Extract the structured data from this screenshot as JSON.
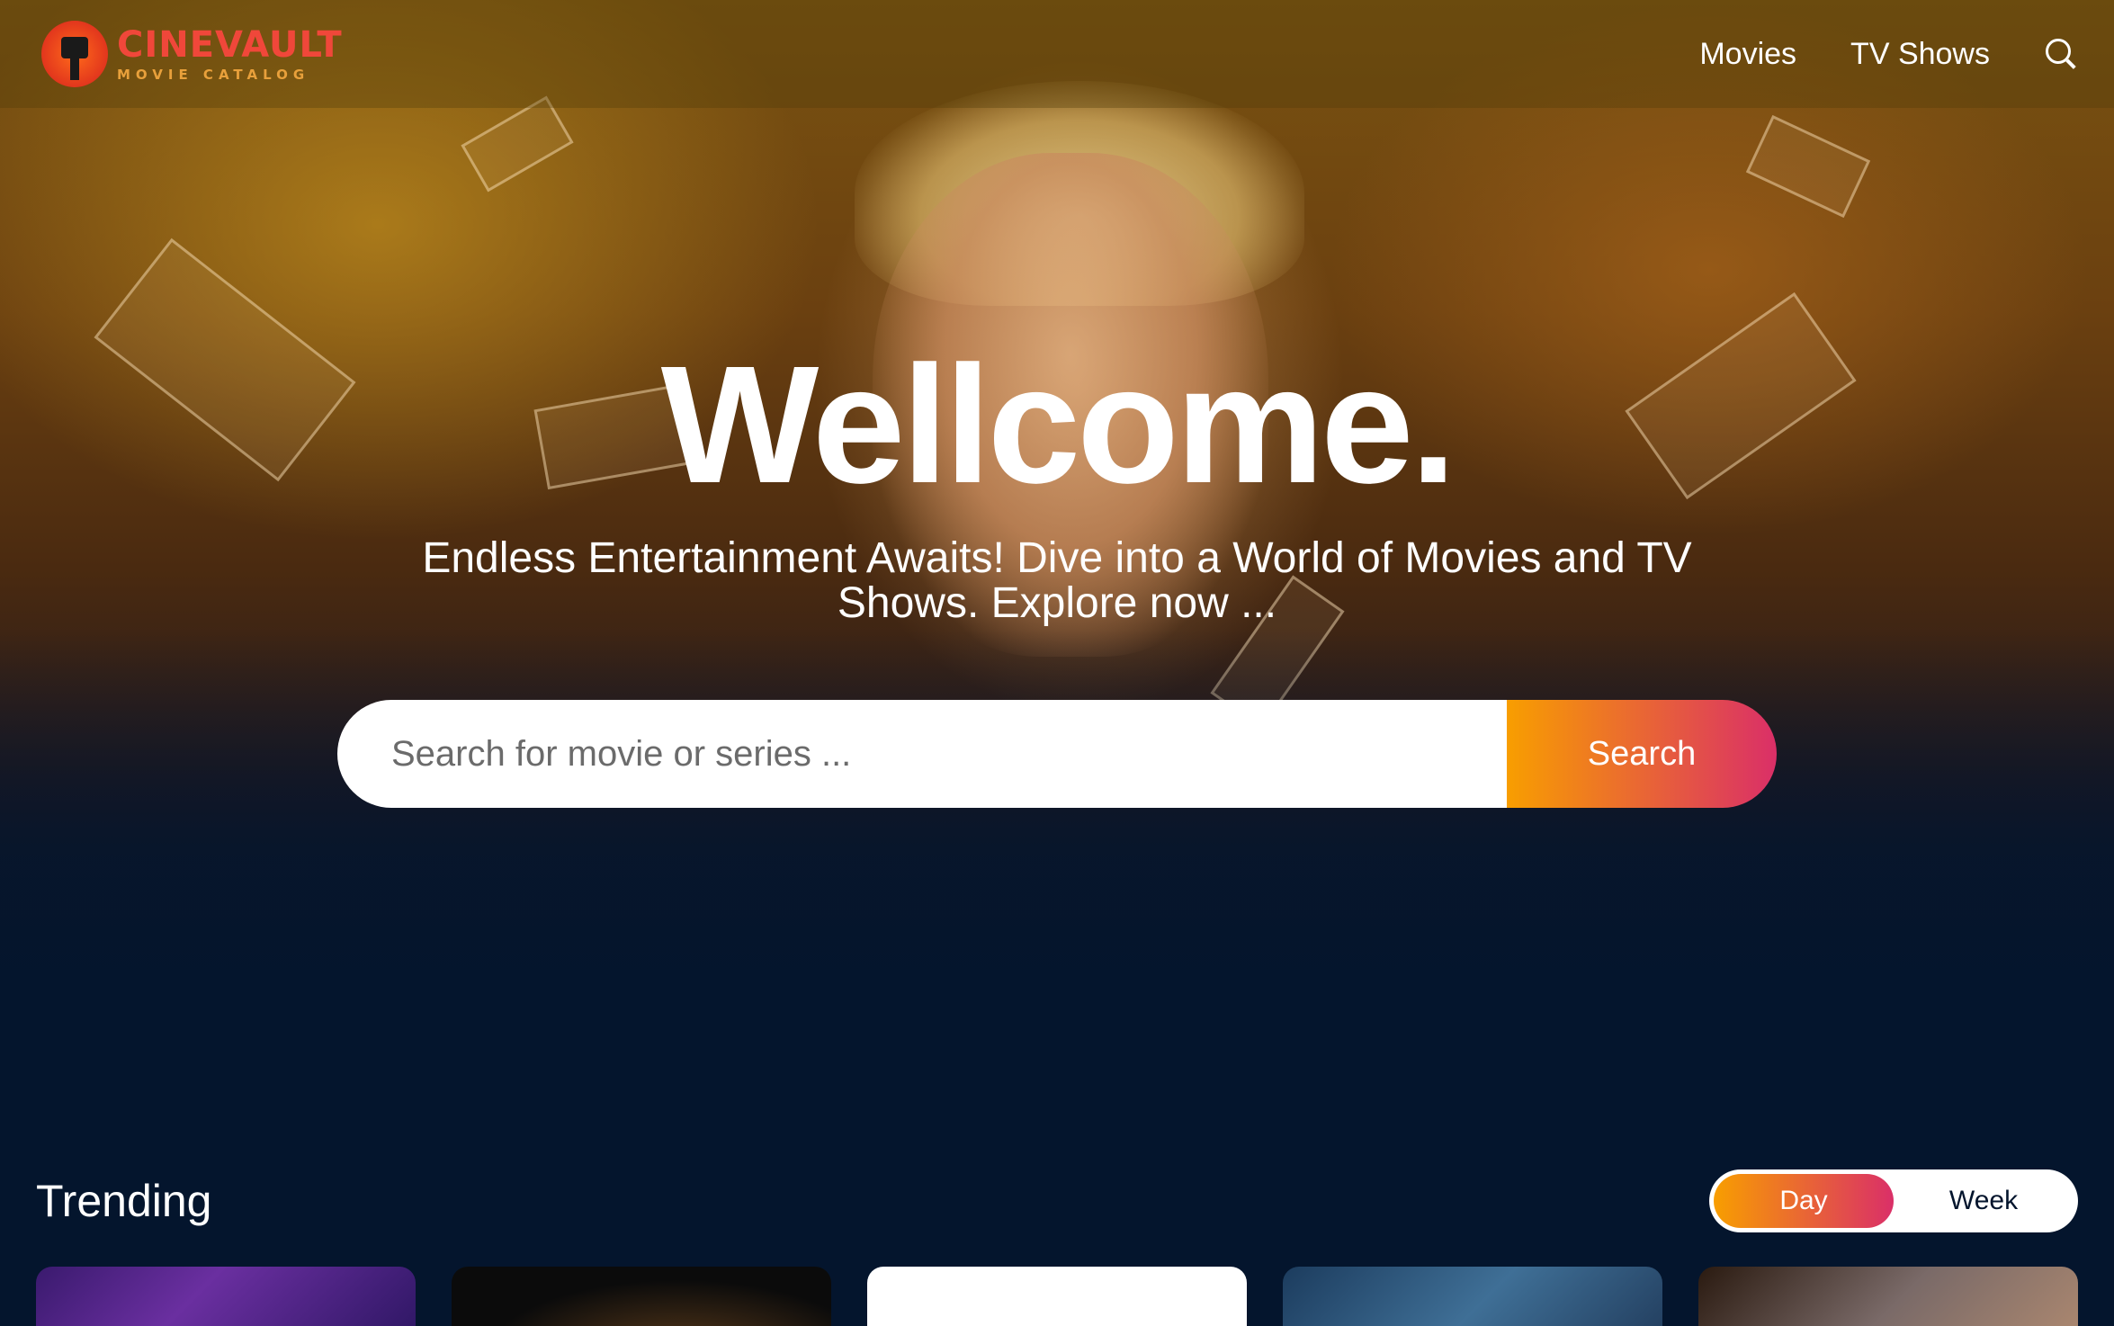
{
  "header": {
    "logo_title": "CINEVAULT",
    "logo_subtitle": "MOVIE CATALOG",
    "nav": [
      {
        "label": "Movies"
      },
      {
        "label": "TV Shows"
      }
    ],
    "search_icon": "search-icon"
  },
  "hero": {
    "title": "Wellcome.",
    "subtitle": "Endless Entertainment Awaits! Dive into a World of Movies and TV Shows. Explore now ...",
    "search": {
      "placeholder": "Search for movie or series ...",
      "value": "",
      "button_label": "Search"
    }
  },
  "trending": {
    "title": "Trending",
    "tabs": [
      {
        "label": "Day",
        "active": true
      },
      {
        "label": "Week",
        "active": false
      }
    ],
    "card_count_visible": 5
  },
  "colors": {
    "background": "#04152d",
    "accent_gradient_start": "#f89e00",
    "accent_gradient_end": "#da2f68",
    "logo_red": "#f0473a",
    "logo_orange": "#e8a03b"
  }
}
